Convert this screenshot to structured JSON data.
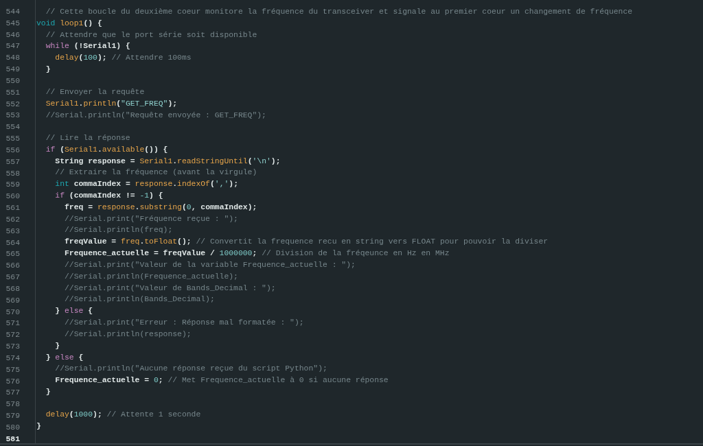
{
  "editor": {
    "lines": [
      {
        "number": "544",
        "current": false,
        "tokens": [
          {
            "kind": "comment",
            "text": "  // Cette boucle du deuxième coeur monitore la fréquence du transceiver et signale au premier coeur un changement de fréquence"
          }
        ]
      },
      {
        "number": "545",
        "current": false,
        "tokens": [
          {
            "kind": "type",
            "text": "void "
          },
          {
            "kind": "function",
            "text": "loop1"
          },
          {
            "kind": "plain",
            "text": "() {"
          }
        ]
      },
      {
        "number": "546",
        "current": false,
        "tokens": [
          {
            "kind": "comment",
            "text": "  // Attendre que le port série soit disponible"
          }
        ]
      },
      {
        "number": "547",
        "current": false,
        "tokens": [
          {
            "kind": "keyword",
            "text": "  while"
          },
          {
            "kind": "plain",
            "text": " (!Serial1) {"
          }
        ]
      },
      {
        "number": "548",
        "current": false,
        "tokens": [
          {
            "kind": "function",
            "text": "    delay"
          },
          {
            "kind": "plain",
            "text": "("
          },
          {
            "kind": "number",
            "text": "100"
          },
          {
            "kind": "plain",
            "text": "); "
          },
          {
            "kind": "comment",
            "text": "// Attendre 100ms"
          }
        ]
      },
      {
        "number": "549",
        "current": false,
        "tokens": [
          {
            "kind": "plain",
            "text": "  }"
          }
        ]
      },
      {
        "number": "550",
        "current": false
      },
      {
        "number": "551",
        "current": false,
        "tokens": [
          {
            "kind": "comment",
            "text": "  // Envoyer la requête"
          }
        ]
      },
      {
        "number": "552",
        "current": false,
        "tokens": [
          {
            "kind": "function",
            "text": "  Serial1"
          },
          {
            "kind": "plain",
            "text": "."
          },
          {
            "kind": "function",
            "text": "println"
          },
          {
            "kind": "plain",
            "text": "("
          },
          {
            "kind": "string",
            "text": "\"GET_FREQ\""
          },
          {
            "kind": "plain",
            "text": ");"
          }
        ]
      },
      {
        "number": "553",
        "current": false,
        "tokens": [
          {
            "kind": "comment",
            "text": "  //Serial.println(\"Requête envoyée : GET_FREQ\");"
          }
        ]
      },
      {
        "number": "554",
        "current": false
      },
      {
        "number": "555",
        "current": false,
        "tokens": [
          {
            "kind": "comment",
            "text": "  // Lire la réponse"
          }
        ]
      },
      {
        "number": "556",
        "current": false,
        "tokens": [
          {
            "kind": "keyword",
            "text": "  if"
          },
          {
            "kind": "plain",
            "text": " ("
          },
          {
            "kind": "function",
            "text": "Serial1"
          },
          {
            "kind": "plain",
            "text": "."
          },
          {
            "kind": "function",
            "text": "available"
          },
          {
            "kind": "plain",
            "text": "()) {"
          }
        ]
      },
      {
        "number": "557",
        "current": false,
        "tokens": [
          {
            "kind": "plain",
            "text": "    String response = "
          },
          {
            "kind": "function",
            "text": "Serial1"
          },
          {
            "kind": "plain",
            "text": "."
          },
          {
            "kind": "function",
            "text": "readStringUntil"
          },
          {
            "kind": "plain",
            "text": "("
          },
          {
            "kind": "string",
            "text": "'\\n'"
          },
          {
            "kind": "plain",
            "text": ");"
          }
        ]
      },
      {
        "number": "558",
        "current": false,
        "tokens": [
          {
            "kind": "comment",
            "text": "    // Extraire la fréquence (avant la virgule)"
          }
        ]
      },
      {
        "number": "559",
        "current": false,
        "tokens": [
          {
            "kind": "type",
            "text": "    int"
          },
          {
            "kind": "plain",
            "text": " commaIndex = "
          },
          {
            "kind": "function",
            "text": "response"
          },
          {
            "kind": "plain",
            "text": "."
          },
          {
            "kind": "function",
            "text": "indexOf"
          },
          {
            "kind": "plain",
            "text": "("
          },
          {
            "kind": "string",
            "text": "','"
          },
          {
            "kind": "plain",
            "text": ");"
          }
        ]
      },
      {
        "number": "560",
        "current": false,
        "tokens": [
          {
            "kind": "keyword",
            "text": "    if"
          },
          {
            "kind": "plain",
            "text": " (commaIndex != "
          },
          {
            "kind": "number",
            "text": "-1"
          },
          {
            "kind": "plain",
            "text": ") {"
          }
        ]
      },
      {
        "number": "561",
        "current": false,
        "tokens": [
          {
            "kind": "plain",
            "text": "      freq = "
          },
          {
            "kind": "function",
            "text": "response"
          },
          {
            "kind": "plain",
            "text": "."
          },
          {
            "kind": "function",
            "text": "substring"
          },
          {
            "kind": "plain",
            "text": "("
          },
          {
            "kind": "number",
            "text": "0"
          },
          {
            "kind": "plain",
            "text": ", commaIndex);"
          }
        ]
      },
      {
        "number": "562",
        "current": false,
        "tokens": [
          {
            "kind": "comment",
            "text": "      //Serial.print(\"Fréquence reçue : \");"
          }
        ]
      },
      {
        "number": "563",
        "current": false,
        "tokens": [
          {
            "kind": "comment",
            "text": "      //Serial.println(freq);"
          }
        ]
      },
      {
        "number": "564",
        "current": false,
        "tokens": [
          {
            "kind": "plain",
            "text": "      freqValue = "
          },
          {
            "kind": "function",
            "text": "freq"
          },
          {
            "kind": "plain",
            "text": "."
          },
          {
            "kind": "function",
            "text": "toFloat"
          },
          {
            "kind": "plain",
            "text": "(); "
          },
          {
            "kind": "comment",
            "text": "// Convertit la frequence recu en string vers FLOAT pour pouvoir la diviser"
          }
        ]
      },
      {
        "number": "565",
        "current": false,
        "tokens": [
          {
            "kind": "plain",
            "text": "      Frequence_actuelle = freqValue / "
          },
          {
            "kind": "number",
            "text": "1000000"
          },
          {
            "kind": "plain",
            "text": "; "
          },
          {
            "kind": "comment",
            "text": "// Division de la fréqeunce en Hz en MHz"
          }
        ]
      },
      {
        "number": "566",
        "current": false,
        "tokens": [
          {
            "kind": "comment",
            "text": "      //Serial.print(\"Valeur de la variable Frequence_actuelle : \");"
          }
        ]
      },
      {
        "number": "567",
        "current": false,
        "tokens": [
          {
            "kind": "comment",
            "text": "      //Serial.println(Frequence_actuelle);"
          }
        ]
      },
      {
        "number": "568",
        "current": false,
        "tokens": [
          {
            "kind": "comment",
            "text": "      //Serial.print(\"Valeur de Bands_Decimal : \");"
          }
        ]
      },
      {
        "number": "569",
        "current": false,
        "tokens": [
          {
            "kind": "comment",
            "text": "      //Serial.println(Bands_Decimal);"
          }
        ]
      },
      {
        "number": "570",
        "current": false,
        "tokens": [
          {
            "kind": "plain",
            "text": "    } "
          },
          {
            "kind": "keyword",
            "text": "else"
          },
          {
            "kind": "plain",
            "text": " {"
          }
        ]
      },
      {
        "number": "571",
        "current": false,
        "tokens": [
          {
            "kind": "comment",
            "text": "      //Serial.print(\"Erreur : Réponse mal formatée : \");"
          }
        ]
      },
      {
        "number": "572",
        "current": false,
        "tokens": [
          {
            "kind": "comment",
            "text": "      //Serial.println(response);"
          }
        ]
      },
      {
        "number": "573",
        "current": false,
        "tokens": [
          {
            "kind": "plain",
            "text": "    }"
          }
        ]
      },
      {
        "number": "574",
        "current": false,
        "tokens": [
          {
            "kind": "plain",
            "text": "  } "
          },
          {
            "kind": "keyword",
            "text": "else"
          },
          {
            "kind": "plain",
            "text": " {"
          }
        ]
      },
      {
        "number": "575",
        "current": false,
        "tokens": [
          {
            "kind": "comment",
            "text": "    //Serial.println(\"Aucune réponse reçue du script Python\");"
          }
        ]
      },
      {
        "number": "576",
        "current": false,
        "tokens": [
          {
            "kind": "plain",
            "text": "    Frequence_actuelle = "
          },
          {
            "kind": "number",
            "text": "0"
          },
          {
            "kind": "plain",
            "text": "; "
          },
          {
            "kind": "comment",
            "text": "// Met Frequence_actuelle à 0 si aucune réponse"
          }
        ]
      },
      {
        "number": "577",
        "current": false,
        "tokens": [
          {
            "kind": "plain",
            "text": "  }"
          }
        ]
      },
      {
        "number": "578",
        "current": false
      },
      {
        "number": "579",
        "current": false,
        "tokens": [
          {
            "kind": "function",
            "text": "  delay"
          },
          {
            "kind": "plain",
            "text": "("
          },
          {
            "kind": "number",
            "text": "1000"
          },
          {
            "kind": "plain",
            "text": "); "
          },
          {
            "kind": "comment",
            "text": "// Attente 1 seconde"
          }
        ]
      },
      {
        "number": "580",
        "current": false,
        "tokens": [
          {
            "kind": "plain",
            "text": "}"
          }
        ]
      },
      {
        "number": "581",
        "current": true
      }
    ]
  }
}
